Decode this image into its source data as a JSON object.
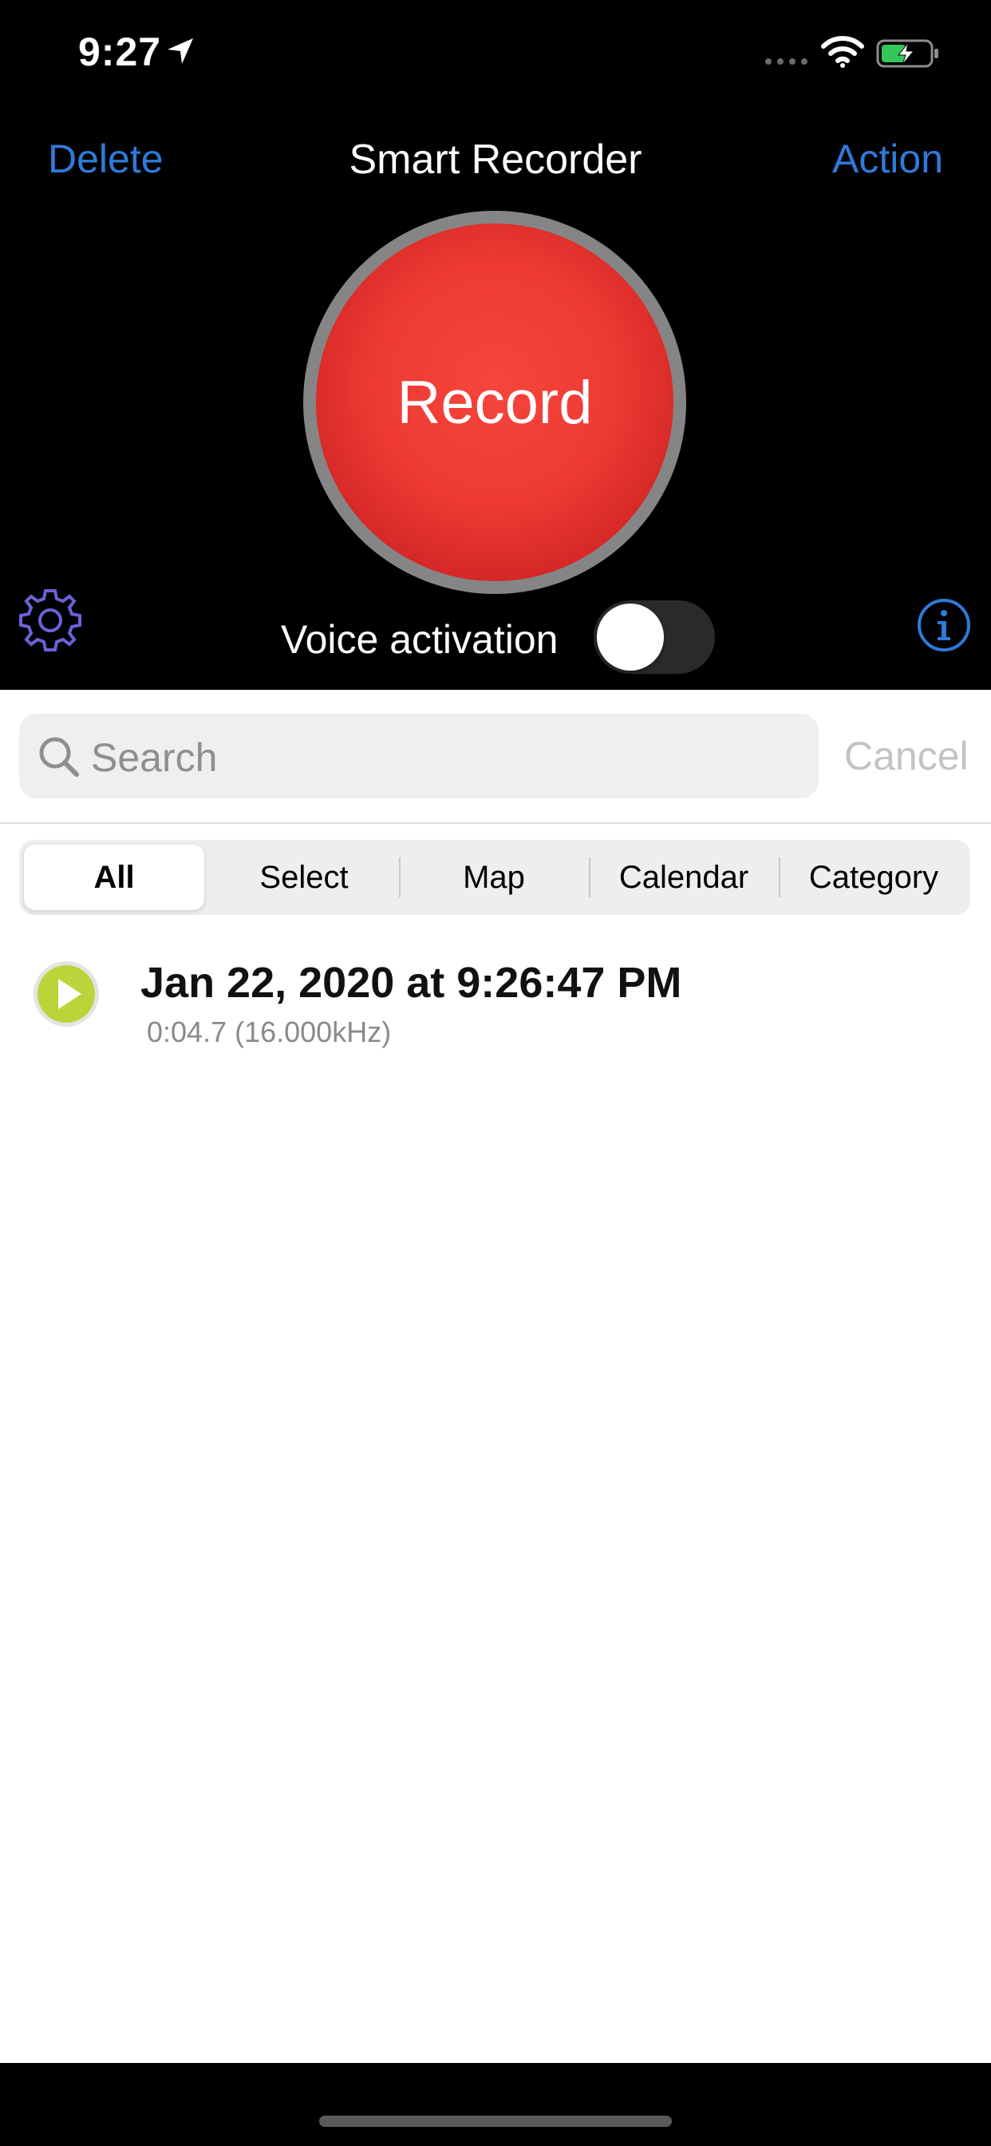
{
  "status_bar": {
    "time": "9:27",
    "icons": [
      "location-arrow-icon",
      "signal-dots-icon",
      "wifi-icon",
      "battery-charging-icon"
    ]
  },
  "nav": {
    "left_label": "Delete",
    "title": "Smart Recorder",
    "right_label": "Action"
  },
  "recorder": {
    "record_label": "Record",
    "voice_activation_label": "Voice activation",
    "voice_activation_on": false
  },
  "search": {
    "placeholder": "Search",
    "cancel_label": "Cancel"
  },
  "segments": {
    "items": [
      "All",
      "Select",
      "Map",
      "Calendar",
      "Category"
    ],
    "selected": "All"
  },
  "recordings": [
    {
      "title": "Jan 22, 2020 at 9:26:47 PM",
      "detail": "0:04.7 (16.000kHz)"
    }
  ],
  "colors": {
    "accent": "#2f7ad9",
    "record_red": "#ee3a33",
    "play_green": "#bcd33a",
    "settings_icon": "#6a62d8"
  }
}
